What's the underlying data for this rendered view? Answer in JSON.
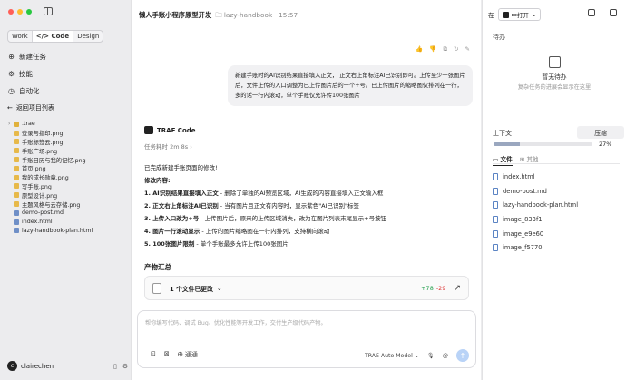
{
  "colors": {
    "close": "#ff5f57",
    "min": "#febc2e",
    "max": "#28c840",
    "plus": "#1e9e4a",
    "minus": "#d33333"
  },
  "modes": [
    "Work",
    "Code",
    "Design"
  ],
  "menu": [
    {
      "icon": "new-task-icon",
      "label": "新建任务"
    },
    {
      "icon": "skills-icon",
      "label": "技能"
    },
    {
      "icon": "automation-icon",
      "label": "自动化"
    }
  ],
  "back_label": "返回项目列表",
  "files": [
    {
      "name": ".trae",
      "type": "folder"
    },
    {
      "name": "登录与指印.png",
      "type": "image"
    },
    {
      "name": "手账标签云.png",
      "type": "image"
    },
    {
      "name": "手账广场.png",
      "type": "image"
    },
    {
      "name": "手账日历与我的记忆.png",
      "type": "image"
    },
    {
      "name": "首页.png",
      "type": "image"
    },
    {
      "name": "我的成长勋章.png",
      "type": "image"
    },
    {
      "name": "写手账.png",
      "type": "image"
    },
    {
      "name": "原型设计.png",
      "type": "image"
    },
    {
      "name": "主题风格与云存储.png",
      "type": "image"
    },
    {
      "name": "demo-post.md",
      "type": "doc"
    },
    {
      "name": "index.html",
      "type": "doc"
    },
    {
      "name": "lazy-handbook-plan.html",
      "type": "doc"
    }
  ],
  "user": {
    "initial": "c",
    "name": "clairechen"
  },
  "main": {
    "title": "懒人手账小程序原型开发",
    "subtitle": "lazy-handbook · 15:57",
    "user_message": "新建手账时的AI识别结果直接填入正文， 正文右上角标注AI已识别即可。上传至少一张图片后，文件上传的入口调整为已上传图片后的一个+号。已上传图片的缩略图仅排列在一行，多的话一行内滚动，单个手账仅允许传100张图片",
    "agent": "TRAE Code",
    "elapsed": "任务耗时 2m 8s",
    "intro": "已完成新建手账页面的修改!",
    "changes_heading": "修改内容:",
    "changes": [
      {
        "b": "1. AI识别结果直接填入正文",
        "t": " - 删除了单独的AI预览区域，AI生成的内容直接填入正文输入框"
      },
      {
        "b": "2. 正文右上角标注AI已识别",
        "t": " - 当有图片且正文有内容时，显示紫色\"AI已识别\"标签"
      },
      {
        "b": "3. 上传入口改为+号",
        "t": " - 上传图片后，原来的上传区域消失，改为在图片列表末尾显示+号按钮"
      },
      {
        "b": "4. 图片一行滚动显示",
        "t": " - 上传的图片缩略图在一行内排列，支持横向滚动"
      },
      {
        "b": "5. 100张图片限制",
        "t": " - 单个手账最多允许上传100张图片"
      }
    ],
    "artifact_title": "产物汇总",
    "artifact_label": "1 个文件已更改",
    "added": "+78",
    "removed": "-29",
    "input_placeholder": "帮你编写代码、调试 Bug、优化性能等开发工作，交付生产级代码产物。",
    "web_label": "通通",
    "model": "TRAE Auto Model"
  },
  "right": {
    "open_in": "在",
    "open_label": "中打开",
    "todo_title": "待办",
    "todo_empty": "暂无待办",
    "todo_hint": "复杂任务的进展会显示在这里",
    "context_title": "上下文",
    "compress": "压缩",
    "context_pct": "27%",
    "context_fraction": 0.27,
    "tab_files": "文件",
    "tab_other": "其他",
    "files": [
      "index.html",
      "demo-post.md",
      "lazy-handbook-plan.html",
      "image_833f1",
      "image_e9e60",
      "image_f5770"
    ]
  }
}
